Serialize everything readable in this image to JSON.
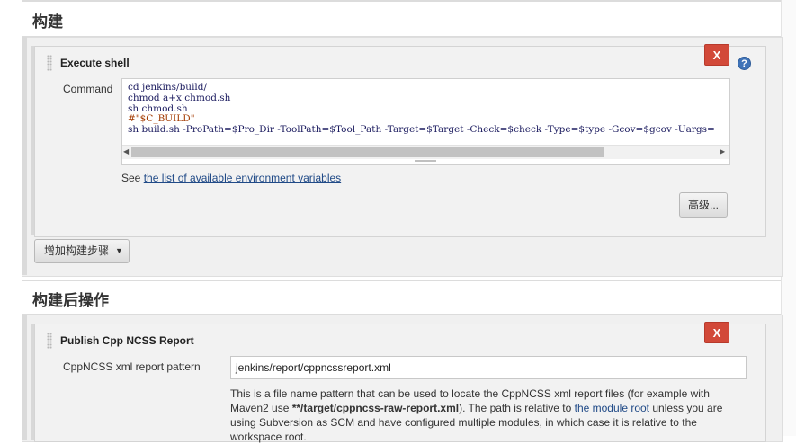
{
  "build_section": {
    "title": "构建",
    "step": {
      "title": "Execute shell",
      "delete_label": "X",
      "help_label": "?",
      "command_label": "Command",
      "command_lines": [
        "cd jenkins/build/",
        "chmod a+x chmod.sh",
        "sh chmod.sh",
        "#\"$C_BUILD\"",
        "sh build.sh -ProPath=$Pro_Dir -ToolPath=$Tool_Path -Target=$Target -Check=$check -Type=$type -Gcov=$gcov -Uargs="
      ],
      "env_prefix": "See",
      "env_link": "the list of available environment variables",
      "advanced_label": "高级..."
    },
    "add_step_label": "增加构建步骤"
  },
  "post_build_section": {
    "title": "构建后操作",
    "step": {
      "title": "Publish Cpp NCSS Report",
      "delete_label": "X",
      "pattern_label": "CppNCSS xml report pattern",
      "pattern_value": "jenkins/report/cppncssreport.xml",
      "desc_part1": "This is a file name pattern that can be used to locate the CppNCSS xml report files (for example with Maven2 use ",
      "desc_bold": "**/target/cppncss-raw-report.xml",
      "desc_part2": "). The path is relative to ",
      "desc_link": "the module root",
      "desc_part3": " unless you are using Subversion as SCM and have configured multiple modules, in which case it is relative to the workspace root."
    }
  }
}
